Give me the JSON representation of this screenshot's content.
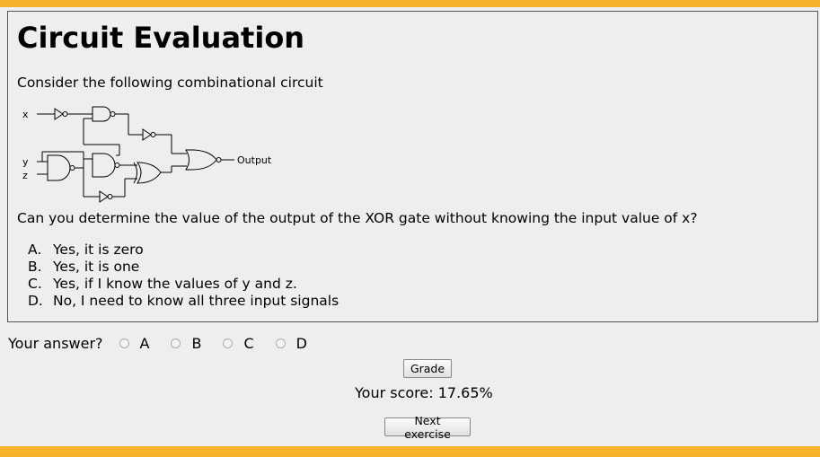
{
  "exercise": {
    "title": "Circuit Evaluation",
    "intro": "Consider the following combinational circuit",
    "question": "Can you determine the value of the output of the XOR gate without knowing the input value of x?",
    "options": [
      {
        "letter": "A.",
        "text": "Yes, it is zero"
      },
      {
        "letter": "B.",
        "text": "Yes, it is one"
      },
      {
        "letter": "C.",
        "text": "Yes, if I know the values of y and z."
      },
      {
        "letter": "D.",
        "text": "No, I need to know all three input signals"
      }
    ]
  },
  "circuit": {
    "inputs": [
      "x",
      "y",
      "z"
    ],
    "output_label": "Output"
  },
  "answer": {
    "prompt": "Your answer?",
    "choices": [
      "A",
      "B",
      "C",
      "D"
    ]
  },
  "controls": {
    "grade_label": "Grade",
    "score_text": "Your score: 17.65%",
    "next_label": "Next exercise"
  },
  "colors": {
    "accent_bar": "#f7b32b",
    "background": "#eeeeee"
  }
}
